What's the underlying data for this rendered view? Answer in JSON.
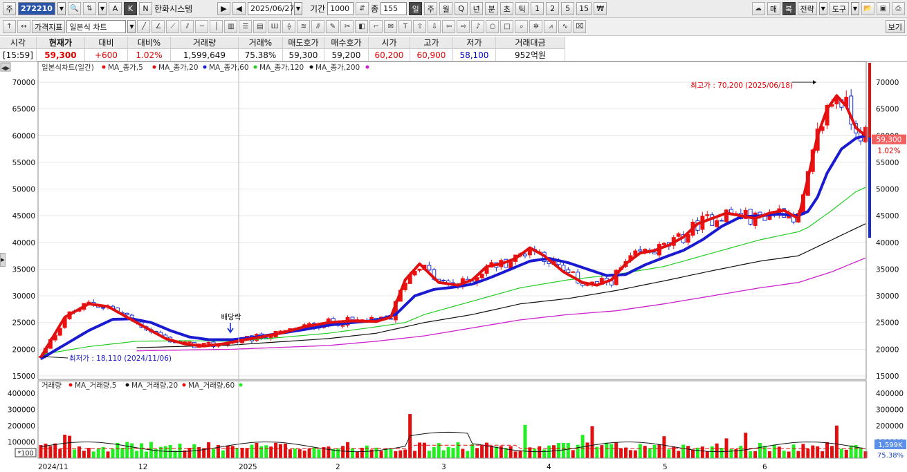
{
  "toolbar1": {
    "type_label": "주",
    "stock_code": "272210",
    "stock_name": "한화시스템",
    "date": "2025/06/27",
    "period_label": "기간",
    "period_value": "1000",
    "count_label": "종",
    "count_value": "155",
    "nav_prev_icon": "triangle-left-icon",
    "nav_next_icon": "triangle-right-icon",
    "mode_buttons": [
      "A",
      "K",
      "N"
    ],
    "intervals": [
      "일",
      "주",
      "월",
      "Q",
      "년",
      "분",
      "초",
      "틱",
      "1",
      "2",
      "5",
      "15",
      "₩"
    ],
    "right_buttons": [
      "매",
      "복",
      "전략",
      "도구"
    ]
  },
  "toolbar2": {
    "price_indicator_label": "가격지표",
    "chart_type_label": "일본식 차트",
    "view_label": "보기"
  },
  "quote": {
    "headers": [
      "시각",
      "현재가",
      "대비",
      "대비%",
      "거래량",
      "거래%",
      "매도호가",
      "매수호가",
      "시가",
      "고가",
      "저가",
      "거래대금"
    ],
    "values": [
      "[15:59]",
      "59,300",
      "+600",
      "1.02%",
      "1,599,649",
      "75.38%",
      "59,300",
      "59,200",
      "60,200",
      "60,900",
      "58,100",
      "952억원"
    ]
  },
  "colors": {
    "up": "#ee1111",
    "down": "#1a2fd0",
    "ma5": "#e01010",
    "ma20": "#1a1ad0",
    "ma60": "#22cc22",
    "ma120": "#111111",
    "ma200": "#cc22cc",
    "vol_up": "#e01010",
    "vol_down": "#22ee22"
  },
  "chart_data": {
    "type": "candlestick",
    "title": "일본식차트(일간)",
    "legend": [
      "MA_종가,5",
      "MA_종가,20",
      "MA_종가,60",
      "MA_종가,120",
      "MA_종가,200"
    ],
    "y_axis": {
      "min": 15000,
      "max": 70000,
      "ticks": [
        15000,
        20000,
        25000,
        30000,
        35000,
        40000,
        45000,
        50000,
        55000,
        60000,
        65000,
        70000
      ]
    },
    "x_labels": [
      "2024/11",
      "12",
      "2025",
      "2",
      "3",
      "4",
      "5",
      "6"
    ],
    "current_price_label": "59,300",
    "current_change_label": "1.02%",
    "annotations": {
      "high": "최고가 : 70,200 (2025/06/18)",
      "low": "최저가 : 18,110 (2024/11/06)",
      "dividend": "배당락"
    },
    "ma5": [
      [
        0,
        18500
      ],
      [
        5,
        26000
      ],
      [
        10,
        28500
      ],
      [
        14,
        28000
      ],
      [
        18,
        26000
      ],
      [
        22,
        24000
      ],
      [
        26,
        22000
      ],
      [
        30,
        21000
      ],
      [
        34,
        20600
      ],
      [
        38,
        21000
      ],
      [
        42,
        21700
      ],
      [
        46,
        22300
      ],
      [
        50,
        23000
      ],
      [
        55,
        24200
      ],
      [
        60,
        25000
      ],
      [
        65,
        25300
      ],
      [
        70,
        25200
      ],
      [
        73,
        26000
      ],
      [
        76,
        33000
      ],
      [
        79,
        36000
      ],
      [
        83,
        32500
      ],
      [
        87,
        32000
      ],
      [
        90,
        33000
      ],
      [
        93,
        35500
      ],
      [
        96,
        36000
      ],
      [
        99,
        37000
      ],
      [
        102,
        39000
      ],
      [
        105,
        37500
      ],
      [
        109,
        34500
      ],
      [
        113,
        32500
      ],
      [
        116,
        32000
      ],
      [
        119,
        33000
      ],
      [
        122,
        36000
      ],
      [
        125,
        38000
      ],
      [
        128,
        38500
      ],
      [
        131,
        39500
      ],
      [
        134,
        41000
      ],
      [
        137,
        43500
      ],
      [
        140,
        44500
      ],
      [
        143,
        45500
      ],
      [
        146,
        45000
      ],
      [
        149,
        44500
      ],
      [
        152,
        45500
      ],
      [
        155,
        46000
      ],
      [
        158,
        44500
      ],
      [
        160,
        52000
      ],
      [
        162,
        60000
      ],
      [
        164,
        65000
      ],
      [
        166,
        67500
      ],
      [
        168,
        65500
      ],
      [
        170,
        61500
      ],
      [
        172,
        60000
      ]
    ],
    "ma20": [
      [
        0,
        18200
      ],
      [
        10,
        23500
      ],
      [
        15,
        25600
      ],
      [
        19,
        25700
      ],
      [
        23,
        25000
      ],
      [
        27,
        23500
      ],
      [
        31,
        22300
      ],
      [
        35,
        21800
      ],
      [
        40,
        21800
      ],
      [
        45,
        22300
      ],
      [
        50,
        23000
      ],
      [
        55,
        23700
      ],
      [
        60,
        24500
      ],
      [
        65,
        25000
      ],
      [
        70,
        25400
      ],
      [
        74,
        26500
      ],
      [
        78,
        30000
      ],
      [
        82,
        31200
      ],
      [
        86,
        31600
      ],
      [
        90,
        32200
      ],
      [
        94,
        33500
      ],
      [
        98,
        35000
      ],
      [
        102,
        36500
      ],
      [
        106,
        37000
      ],
      [
        110,
        36200
      ],
      [
        114,
        35000
      ],
      [
        118,
        33800
      ],
      [
        122,
        34000
      ],
      [
        126,
        35800
      ],
      [
        130,
        37200
      ],
      [
        134,
        38500
      ],
      [
        138,
        40500
      ],
      [
        142,
        43000
      ],
      [
        146,
        44800
      ],
      [
        150,
        45000
      ],
      [
        154,
        45300
      ],
      [
        158,
        45000
      ],
      [
        160,
        45800
      ],
      [
        162,
        48500
      ],
      [
        164,
        53000
      ],
      [
        167,
        57500
      ],
      [
        170,
        59500
      ],
      [
        172,
        60000
      ]
    ],
    "ma60": [
      [
        0,
        19000
      ],
      [
        10,
        20500
      ],
      [
        20,
        21500
      ],
      [
        30,
        21600
      ],
      [
        40,
        21500
      ],
      [
        50,
        22200
      ],
      [
        60,
        23000
      ],
      [
        70,
        24200
      ],
      [
        76,
        25000
      ],
      [
        80,
        26500
      ],
      [
        90,
        29000
      ],
      [
        100,
        31500
      ],
      [
        110,
        33000
      ],
      [
        120,
        34000
      ],
      [
        130,
        35500
      ],
      [
        140,
        38000
      ],
      [
        150,
        40500
      ],
      [
        158,
        42000
      ],
      [
        160,
        42800
      ],
      [
        165,
        46000
      ],
      [
        170,
        49500
      ],
      [
        172,
        50300
      ]
    ],
    "ma120": [
      [
        20,
        20300
      ],
      [
        40,
        20800
      ],
      [
        60,
        22000
      ],
      [
        70,
        23000
      ],
      [
        80,
        25000
      ],
      [
        90,
        26500
      ],
      [
        100,
        28500
      ],
      [
        110,
        29500
      ],
      [
        120,
        31000
      ],
      [
        130,
        32800
      ],
      [
        140,
        34700
      ],
      [
        150,
        36500
      ],
      [
        158,
        37500
      ],
      [
        165,
        40500
      ],
      [
        172,
        43500
      ]
    ],
    "ma200": [
      [
        20,
        19700
      ],
      [
        40,
        20000
      ],
      [
        60,
        20700
      ],
      [
        70,
        21500
      ],
      [
        80,
        22500
      ],
      [
        90,
        24000
      ],
      [
        100,
        25500
      ],
      [
        110,
        26500
      ],
      [
        120,
        27200
      ],
      [
        130,
        28500
      ],
      [
        140,
        30000
      ],
      [
        150,
        31500
      ],
      [
        158,
        32500
      ],
      [
        165,
        34500
      ],
      [
        172,
        37100
      ]
    ],
    "volume": {
      "title": "거래량",
      "legend": [
        "MA_거래량,5",
        "MA_거래량,20",
        "MA_거래량,60"
      ],
      "y_ticks": [
        100000,
        200000,
        300000,
        400000
      ],
      "y_max": 460000,
      "unit_label": "*100",
      "right_labels": [
        "1,599K",
        "75.38%"
      ]
    }
  }
}
